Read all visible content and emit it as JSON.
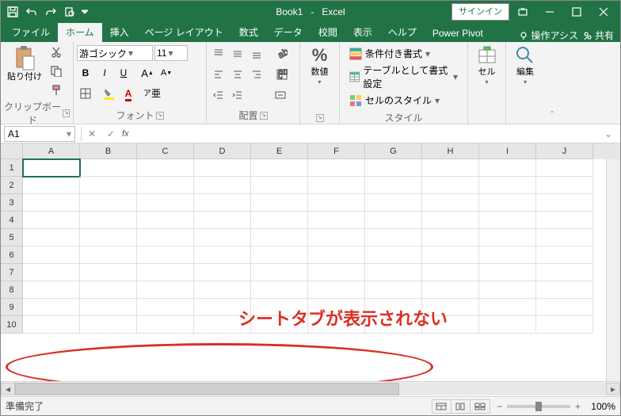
{
  "titlebar": {
    "doc_name": "Book1",
    "app_name": "Excel",
    "signin": "サインイン"
  },
  "tabs": {
    "file": "ファイル",
    "home": "ホーム",
    "insert": "挿入",
    "page_layout": "ページ レイアウト",
    "formulas": "数式",
    "data": "データ",
    "review": "校閲",
    "view": "表示",
    "help": "ヘルプ",
    "power_pivot": "Power Pivot",
    "tell_me": "操作アシス",
    "share": "共有"
  },
  "ribbon": {
    "clipboard": {
      "paste": "貼り付け",
      "label": "クリップボード"
    },
    "font": {
      "name": "游ゴシック",
      "size": "11",
      "label": "フォント"
    },
    "alignment": {
      "label": "配置"
    },
    "number": {
      "big": "%",
      "label": "数値"
    },
    "styles": {
      "conditional": "条件付き書式",
      "table": "テーブルとして書式設定",
      "cell": "セルのスタイル",
      "label": "スタイル"
    },
    "cells": {
      "big": "セル"
    },
    "editing": {
      "big": "編集"
    }
  },
  "namebox": {
    "value": "A1"
  },
  "columns": [
    "A",
    "B",
    "C",
    "D",
    "E",
    "F",
    "G",
    "H",
    "I",
    "J"
  ],
  "rows": [
    "1",
    "2",
    "3",
    "4",
    "5",
    "6",
    "7",
    "8",
    "9",
    "10"
  ],
  "annotation": "シートタブが表示されない",
  "status": {
    "ready": "準備完了",
    "zoom": "100%"
  }
}
